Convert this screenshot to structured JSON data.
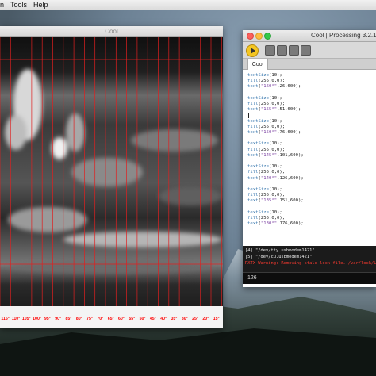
{
  "menubar": {
    "items": [
      "n",
      "Tools",
      "Help"
    ]
  },
  "sketch": {
    "title": "Cool",
    "labels": [
      "115°",
      "110°",
      "105°",
      "100°",
      "95°",
      "90°",
      "85°",
      "80°",
      "75°",
      "70°",
      "65°",
      "60°",
      "55°",
      "50°",
      "45°",
      "40°",
      "35°",
      "30°",
      "25°",
      "20°",
      "15°"
    ],
    "label_color": "#ff0000",
    "grid_color": "#e02020"
  },
  "ide": {
    "title": "Cool | Processing 3.2.1",
    "tab": "Cool",
    "code": [
      "textSize(10);",
      "fill(255,0,0);",
      "text(\"160°\",26,600);",
      "",
      "textSize(10);",
      "fill(255,0,0);",
      "text(\"155°\",51,600);",
      "",
      "textSize(10);",
      "fill(255,0,0);",
      "text(\"150°\",76,600);",
      "",
      "textSize(10);",
      "fill(255,0,0);",
      "text(\"145°\",101,600);",
      "",
      "textSize(10);",
      "fill(255,0,0);",
      "text(\"140°\",126,600);",
      "",
      "textSize(10);",
      "fill(255,0,0);",
      "text(\"135°\",151,600);",
      "",
      "textSize(10);",
      "fill(255,0,0);",
      "text(\"130°\",176,600);"
    ],
    "keyword_color": "#3c7ab0",
    "string_color": "#7a3fa0"
  },
  "console": {
    "lines": [
      {
        "text": "[4] \"/dev/tty.usbmodem1421\"",
        "color": "#e8e8e8"
      },
      {
        "text": "[5] \"/dev/cu.usbmodem1421\"",
        "color": "#e8e8e8"
      },
      {
        "text": "RXTX Warning:  Removing stale lock file. /var/lock/LK",
        "color": "#ff3b30"
      }
    ],
    "status_value": "126"
  }
}
